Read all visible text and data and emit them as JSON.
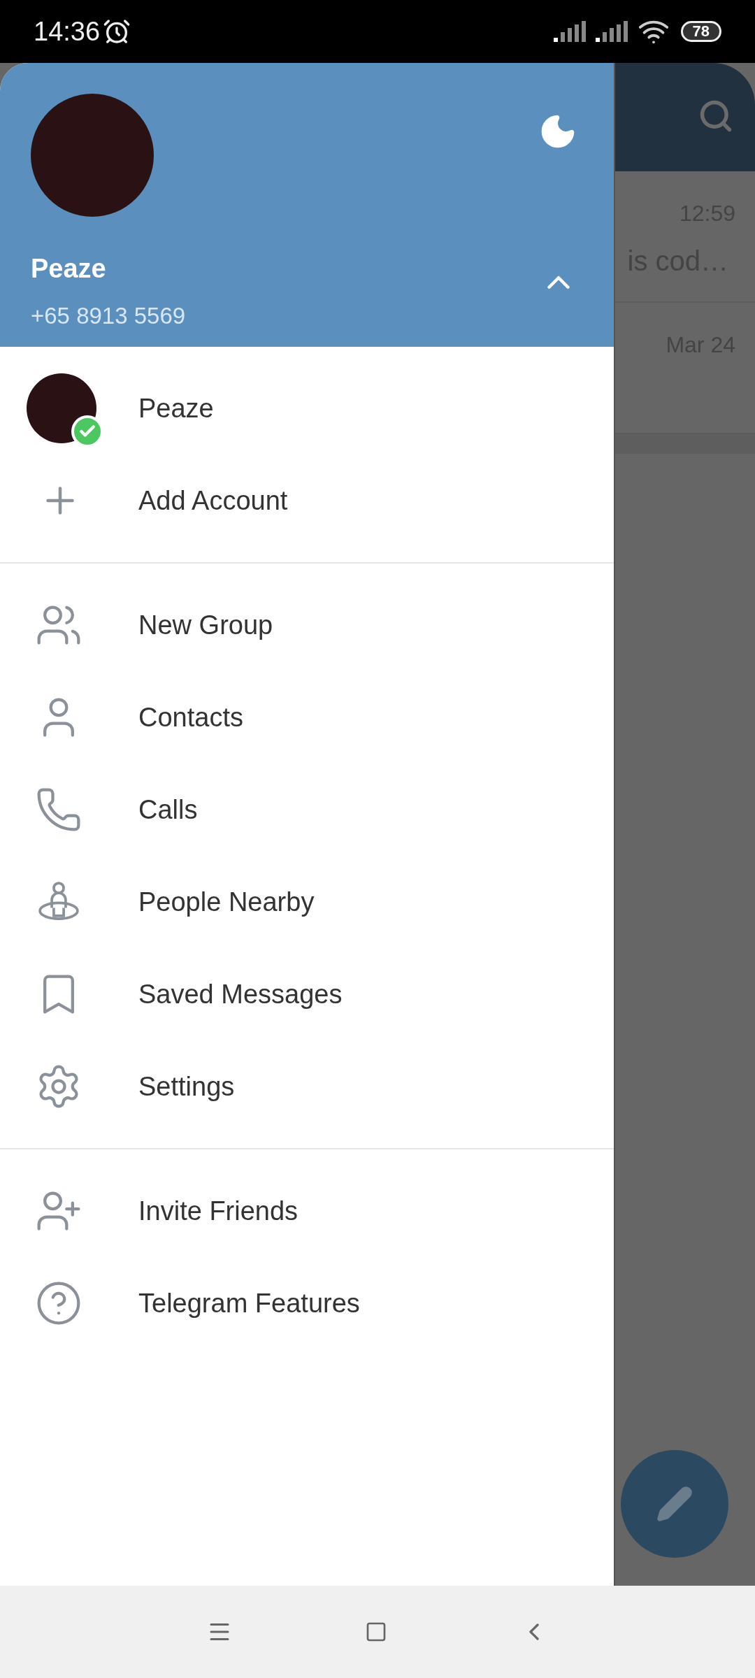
{
  "status_bar": {
    "time": "14:36",
    "battery": "78"
  },
  "drawer": {
    "name": "Peaze",
    "phone": "+65 8913 5569",
    "accounts": [
      {
        "name": "Peaze",
        "selected": true
      }
    ],
    "add_account": "Add Account",
    "sections": [
      [
        {
          "label": "New Group"
        },
        {
          "label": "Contacts"
        },
        {
          "label": "Calls"
        },
        {
          "label": "People Nearby"
        },
        {
          "label": "Saved Messages"
        },
        {
          "label": "Settings"
        }
      ],
      [
        {
          "label": "Invite Friends"
        },
        {
          "label": "Telegram Features"
        }
      ]
    ]
  },
  "chat_list": [
    {
      "time": "12:59",
      "preview": "is cod…"
    },
    {
      "time": "Mar 24"
    }
  ]
}
